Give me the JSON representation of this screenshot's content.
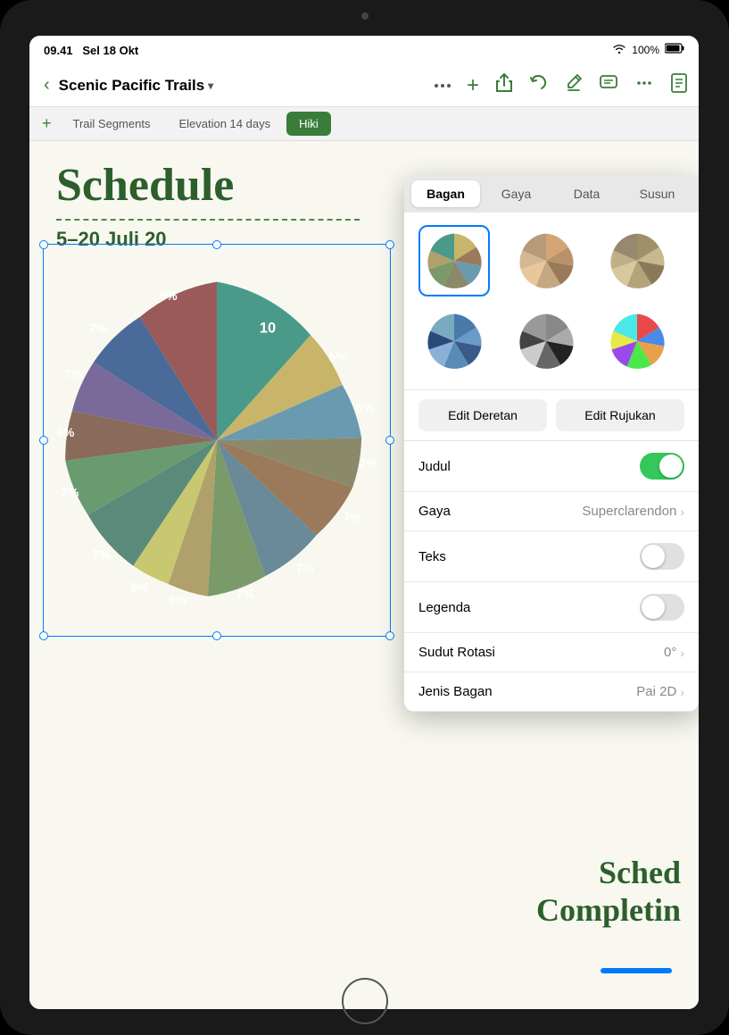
{
  "status_bar": {
    "time": "09.41",
    "day": "Sel 18 Okt",
    "wifi": "📶",
    "battery_pct": "100%"
  },
  "toolbar": {
    "back_icon": "‹",
    "doc_title": "Scenic Pacific Trails",
    "chevron": "▾",
    "add_icon": "+",
    "share_icon": "↑",
    "undo_icon": "↩",
    "markup_icon": "✏",
    "comment_icon": "☰",
    "more_icon": "•••",
    "doc_icon": "📄"
  },
  "sheet_tabs": {
    "add_label": "+",
    "tabs": [
      {
        "id": "trail",
        "label": "Trail Segments",
        "active": false
      },
      {
        "id": "elevation",
        "label": "Elevation 14 days",
        "active": false
      },
      {
        "id": "hiking",
        "label": "Hiki",
        "active": true
      }
    ]
  },
  "document": {
    "schedule_title": "Schedule",
    "date_range": "5–20 Juli 20",
    "bottom_text_1": "Sched",
    "bottom_text_2": "Completin"
  },
  "pie_chart": {
    "segments": [
      {
        "label": "10",
        "percent": null,
        "color": "#4a9a8a",
        "start": 0,
        "end": 36
      },
      {
        "label": "5%",
        "percent": 5,
        "color": "#c8b56a",
        "start": 36,
        "end": 54
      },
      {
        "label": "6%",
        "percent": 6,
        "color": "#6a9ab0",
        "start": 54,
        "end": 75.6
      },
      {
        "label": "7%",
        "percent": 7,
        "color": "#8a8a6a",
        "start": 75.6,
        "end": 100.8
      },
      {
        "label": "7%",
        "percent": 7,
        "color": "#9a7a5a",
        "start": 100.8,
        "end": 126
      },
      {
        "label": "7%",
        "percent": 7,
        "color": "#6a8a9a",
        "start": 126,
        "end": 151.2
      },
      {
        "label": "7%",
        "percent": 7,
        "color": "#7a9a6a",
        "start": 151.2,
        "end": 176.4
      },
      {
        "label": "6%",
        "percent": 6,
        "color": "#b0a06a",
        "start": 176.4,
        "end": 198
      },
      {
        "label": "5%",
        "percent": 5,
        "color": "#c8c870",
        "start": 198,
        "end": 216
      },
      {
        "label": "7%",
        "percent": 7,
        "color": "#5a8a7a",
        "start": 216,
        "end": 241.2
      },
      {
        "label": "7%",
        "percent": 7,
        "color": "#6a9a70",
        "start": 241.2,
        "end": 266.4
      },
      {
        "label": "6%",
        "percent": 6,
        "color": "#8a6a5a",
        "start": 266.4,
        "end": 288
      },
      {
        "label": "7%",
        "percent": 7,
        "color": "#7a6a9a",
        "start": 288,
        "end": 313.2
      },
      {
        "label": "7%",
        "percent": 7,
        "color": "#4a6a9a",
        "start": 313.2,
        "end": 338.4
      },
      {
        "label": "6%",
        "percent": 6,
        "color": "#9a5a5a",
        "start": 338.4,
        "end": 360
      }
    ]
  },
  "format_panel": {
    "tabs": [
      {
        "id": "bagan",
        "label": "Bagan",
        "active": true
      },
      {
        "id": "gaya",
        "label": "Gaya",
        "active": false
      },
      {
        "id": "data",
        "label": "Data",
        "active": false
      },
      {
        "id": "susun",
        "label": "Susun",
        "active": false
      }
    ],
    "chart_styles": [
      {
        "id": "style1",
        "selected": true
      },
      {
        "id": "style2",
        "selected": false
      },
      {
        "id": "style3",
        "selected": false
      },
      {
        "id": "style4",
        "selected": false
      },
      {
        "id": "style5",
        "selected": false
      },
      {
        "id": "style6",
        "selected": false
      }
    ],
    "edit_row_label": "Edit Deretan",
    "edit_ref_label": "Edit Rujukan",
    "settings": [
      {
        "id": "judul",
        "label": "Judul",
        "type": "toggle",
        "toggle_on": true
      },
      {
        "id": "gaya",
        "label": "Gaya",
        "type": "value",
        "value": "Superclarendon",
        "has_chevron": true
      },
      {
        "id": "teks",
        "label": "Teks",
        "type": "toggle",
        "toggle_on": false
      },
      {
        "id": "legenda",
        "label": "Legenda",
        "type": "toggle",
        "toggle_on": false
      },
      {
        "id": "sudut_rotasi",
        "label": "Sudut Rotasi",
        "type": "value",
        "value": "0°",
        "has_chevron": true
      },
      {
        "id": "jenis_bagan",
        "label": "Jenis Bagan",
        "type": "value",
        "value": "Pai 2D",
        "has_chevron": true
      }
    ]
  }
}
